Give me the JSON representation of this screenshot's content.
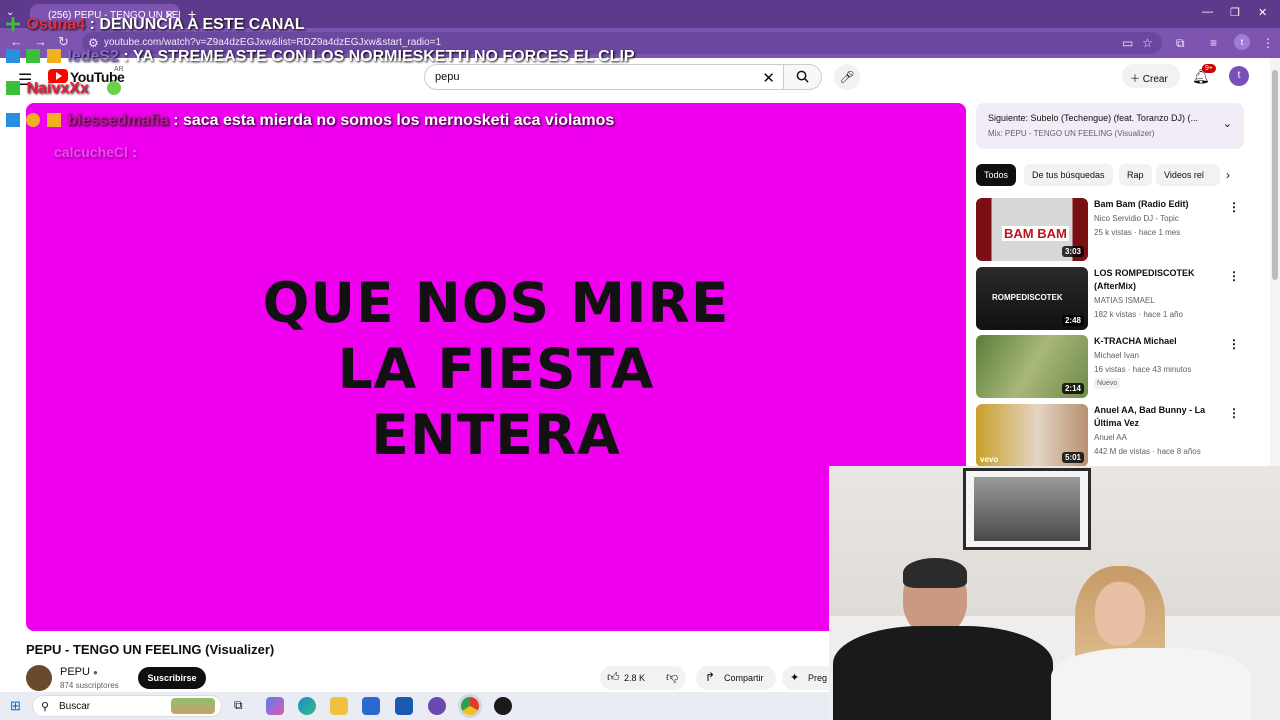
{
  "browser": {
    "tab_title": "(256) PEPU - TENGO UN FEELI",
    "url": "youtube.com/watch?v=Z9a4dzEGJxw&list=RDZ9a4dzEGJxw&start_radio=1",
    "profile_initial": "t"
  },
  "header": {
    "logo_text": "YouTube",
    "region": "AR",
    "search_query": "pepu",
    "create_label": "Crear",
    "notif_count": "9+",
    "avatar_initial": "t"
  },
  "player": {
    "lyric_lines": [
      "QUE NOS MIRE",
      "LA FIESTA",
      "ENTERA"
    ]
  },
  "chat": [
    {
      "user": "Osuna4",
      "message": ": DENUNCIA A ESTE CANAL",
      "user_color": "#e0304a"
    },
    {
      "user": "ledeS2",
      "message": ": YA STREMEASTE CON LOS NORMIESKETTI NO FORCES EL CLIP",
      "user_color": "#8a6ad0"
    },
    {
      "user": "NaivxXx",
      "message": "",
      "user_color": "#e8203a"
    },
    {
      "user": "blessedmafia",
      "message": ": saca esta mierda no somos los mernosketi aca violamos",
      "user_color": "#b0208a"
    },
    {
      "user": "calcucheCl",
      "message": ":",
      "user_color": "#d050d0"
    }
  ],
  "video": {
    "title": "PEPU - TENGO UN FEELING (Visualizer)",
    "channel_name": "PEPU",
    "subscribers": "874 suscriptores",
    "subscribe_label": "Suscribirse",
    "likes": "2.8 K",
    "share_label": "Compartir",
    "ask_label": "Preg"
  },
  "sidebar": {
    "next_title": "Siguiente: Subelo (Techengue) (feat. Toranzo DJ) (...",
    "next_sub": "Mix: PEPU - TENGO UN FEELING (Visualizer)",
    "chips": [
      "Todos",
      "De tus búsquedas",
      "Rap",
      "Videos rel"
    ],
    "recommendations": [
      {
        "title": "Bam Bam (Radio Edit)",
        "channel": "Nico Servidio DJ - Topic",
        "meta": "25 k vistas · hace 1 mes",
        "duration": "3:03",
        "thumb_text": "BAM BAM",
        "badge": ""
      },
      {
        "title": "LOS ROMPEDISCOTEK (AfterMix)",
        "channel": "MATIAS ISMAEL",
        "meta": "182 k vistas · hace 1 año",
        "duration": "2:48",
        "thumb_text": "ROMPEDISCOTEK",
        "badge": ""
      },
      {
        "title": "K-TRACHA Michael",
        "channel": "Michael Ivan",
        "meta": "16 vistas · hace 43 minutos",
        "duration": "2:14",
        "thumb_text": "",
        "badge": "Nuevo"
      },
      {
        "title": "Anuel AA, Bad Bunny - La Última Vez",
        "channel": "Anuel AA",
        "meta": "442 M de vistas · hace 8 años",
        "duration": "5:01",
        "thumb_text": "vevo",
        "badge": ""
      }
    ]
  },
  "taskbar": {
    "search_label": "Buscar"
  },
  "colors": {
    "player_bg": "#ee00ee",
    "browser_frame": "#7d55b0",
    "subscribe_bg": "#0f0f0f"
  }
}
